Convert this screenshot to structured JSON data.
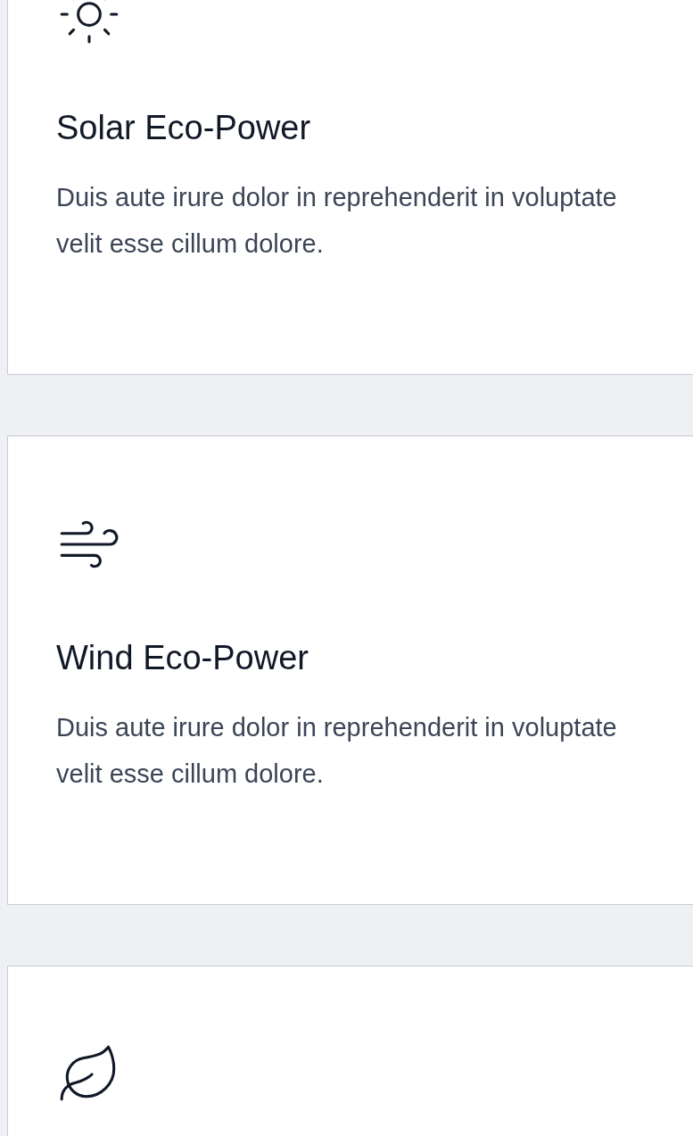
{
  "cards": [
    {
      "kind": "sun",
      "title": "Solar Eco-Power",
      "description": "Duis aute irure dolor in reprehenderit in voluptate velit esse cillum dolore."
    },
    {
      "kind": "wind",
      "title": "Wind Eco-Power",
      "description": "Duis aute irure dolor in reprehenderit in voluptate velit esse cillum dolore."
    },
    {
      "kind": "leaf"
    }
  ]
}
